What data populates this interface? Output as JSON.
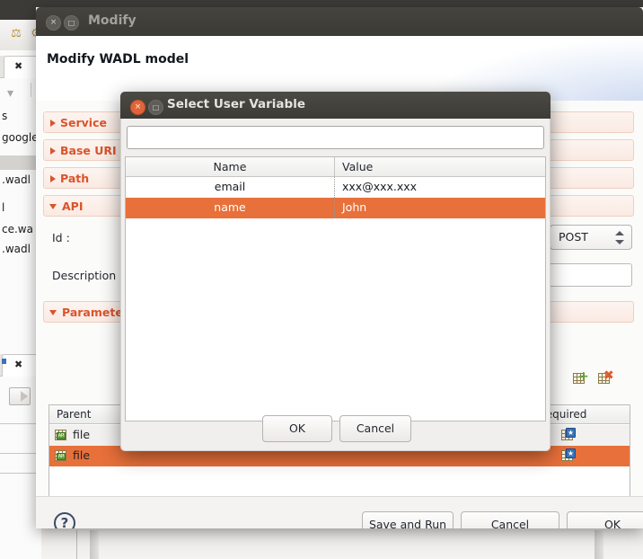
{
  "ide": {
    "tree_fragments": [
      "s",
      "google",
      ".wadl",
      "l",
      "ce.wa",
      ".wadl"
    ],
    "close_icon_label": "close-tab"
  },
  "modify_window": {
    "titlebar": {
      "title": "Modify",
      "close_label": "×",
      "minmax_label": "□"
    },
    "header_title": "Modify WADL model",
    "sections": [
      {
        "label": "Service",
        "expanded": false
      },
      {
        "label": "Base URI",
        "expanded": false
      },
      {
        "label": "Path",
        "expanded": false
      },
      {
        "label": "API",
        "expanded": true
      },
      {
        "label": "Parameters",
        "expanded": true
      }
    ],
    "api_fields": {
      "id_label": "Id :",
      "id_value": "",
      "description_label": "Description",
      "description_value": "",
      "method_value": "POST"
    },
    "param_table": {
      "columns": [
        "Parent",
        "Required"
      ],
      "rows": [
        {
          "parent": "file",
          "icon": "api-table-icon",
          "required_icon": "table-star-icon",
          "selected": false
        },
        {
          "parent": "file",
          "icon": "api-table-icon",
          "required_icon": "table-star-icon",
          "selected": true
        }
      ],
      "toolbar": {
        "add_label": "add-table-row",
        "remove_label": "remove-table-row"
      }
    },
    "footer": {
      "help_label": "?",
      "buttons": [
        "Save and Run",
        "Cancel",
        "OK"
      ]
    }
  },
  "select_dialog": {
    "titlebar": {
      "title": "Select User Variable",
      "close_label": "×",
      "minmax_label": "□"
    },
    "search": {
      "value": "",
      "placeholder": ""
    },
    "table": {
      "columns": [
        "Name",
        "Value"
      ],
      "rows": [
        {
          "name": "email",
          "value": "xxx@xxx.xxx",
          "selected": false
        },
        {
          "name": "name",
          "value": "John",
          "selected": true
        }
      ]
    },
    "buttons": {
      "ok": "OK",
      "cancel": "Cancel"
    }
  },
  "colors": {
    "accent_orange": "#e8703a",
    "section_orange": "#d9542b",
    "titlebar_dark": "#3d3b36",
    "close_active": "#e0643a"
  }
}
